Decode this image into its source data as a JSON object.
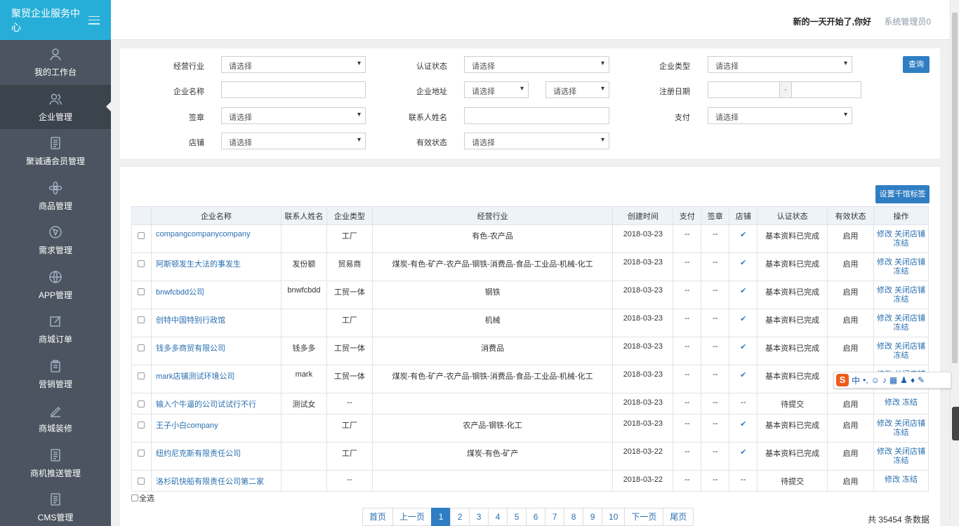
{
  "brand": {
    "title": "聚贸企业服务中心"
  },
  "sidebar": {
    "items": [
      {
        "label": "我的工作台",
        "icon": "user-icon"
      },
      {
        "label": "企业管理",
        "icon": "users-icon"
      },
      {
        "label": "聚诚通会员管理",
        "icon": "document-icon"
      },
      {
        "label": "商品管理",
        "icon": "flower-icon"
      },
      {
        "label": "需求管理",
        "icon": "compass-icon"
      },
      {
        "label": "APP管理",
        "icon": "globe-icon"
      },
      {
        "label": "商城订单",
        "icon": "edit-icon"
      },
      {
        "label": "营销管理",
        "icon": "clipboard-icon"
      },
      {
        "label": "商城装修",
        "icon": "pen-icon"
      },
      {
        "label": "商机推送管理",
        "icon": "document-icon"
      },
      {
        "label": "CMS管理",
        "icon": "document-icon"
      }
    ]
  },
  "header": {
    "greeting": "新的一天开始了,你好",
    "user": "系统管理员0"
  },
  "filters": {
    "industry_label": "经营行业",
    "industry_value": "请选择",
    "cert_label": "认证状态",
    "cert_value": "请选择",
    "type_label": "企业类型",
    "type_value": "请选择",
    "search_button": "查询",
    "name_label": "企业名称",
    "addr_label": "企业地址",
    "addr_value1": "请选择",
    "addr_value2": "请选择",
    "reg_label": "注册日期",
    "reg_sep": "-",
    "sign_label": "签章",
    "sign_value": "请选择",
    "contact_label": "联系人姓名",
    "pay_label": "支付",
    "pay_value": "请选择",
    "shop_label": "店铺",
    "shop_value": "请选择",
    "valid_label": "有效状态",
    "valid_value": "请选择"
  },
  "table": {
    "tag_button": "设置千馆标签",
    "headers": [
      "企业名称",
      "联系人姓名",
      "企业类型",
      "经营行业",
      "创建时间",
      "支付",
      "签章",
      "店铺",
      "认证状态",
      "有效状态",
      "操作"
    ],
    "rows": [
      {
        "name": "compangcompanycompany",
        "contact": "",
        "type": "工厂",
        "industry": "有色-农产品",
        "created": "2018-03-23",
        "pay": "--",
        "sign": "--",
        "shop": "✔",
        "cert": "基本资料已完成",
        "valid": "启用",
        "ops1": "修改 关闭店铺",
        "ops2": "冻结"
      },
      {
        "name": "阿斯顿发生大法的事发生",
        "contact": "发份额",
        "type": "贸易商",
        "industry": "煤炭-有色-矿产-农产品-钢铁-消费品-食品-工业品-机械-化工",
        "created": "2018-03-23",
        "pay": "--",
        "sign": "--",
        "shop": "✔",
        "cert": "基本资料已完成",
        "valid": "启用",
        "ops1": "修改 关闭店铺",
        "ops2": "冻结"
      },
      {
        "name": "bnwfcbdd公司",
        "contact": "bnwfcbdd",
        "type": "工贸一体",
        "industry": "钢铁",
        "created": "2018-03-23",
        "pay": "--",
        "sign": "--",
        "shop": "✔",
        "cert": "基本资料已完成",
        "valid": "启用",
        "ops1": "修改 关闭店铺",
        "ops2": "冻结"
      },
      {
        "name": "创特中国特别行政馆",
        "contact": "",
        "type": "工厂",
        "industry": "机械",
        "created": "2018-03-23",
        "pay": "--",
        "sign": "--",
        "shop": "✔",
        "cert": "基本资料已完成",
        "valid": "启用",
        "ops1": "修改 关闭店铺",
        "ops2": "冻结"
      },
      {
        "name": "钱多多商贸有限公司",
        "contact": "钱多多",
        "type": "工贸一体",
        "industry": "消费品",
        "created": "2018-03-23",
        "pay": "--",
        "sign": "--",
        "shop": "✔",
        "cert": "基本资料已完成",
        "valid": "启用",
        "ops1": "修改 关闭店铺",
        "ops2": "冻结"
      },
      {
        "name": "mark店铺测试环境公司",
        "contact": "mark",
        "type": "工贸一体",
        "industry": "煤炭-有色-矿产-农产品-钢铁-消费品-食品-工业品-机械-化工",
        "created": "2018-03-23",
        "pay": "--",
        "sign": "--",
        "shop": "✔",
        "cert": "基本资料已完成",
        "valid": "启用",
        "ops1": "修改 关闭店铺",
        "ops2": "冻结"
      },
      {
        "name": "输入个牛逼的公司试试行不行",
        "contact": "测试女",
        "type": "--",
        "industry": "",
        "created": "2018-03-23",
        "pay": "--",
        "sign": "--",
        "shop": "--",
        "cert": "待提交",
        "valid": "启用",
        "ops1": "修改 冻结",
        "ops2": ""
      },
      {
        "name": "王子小白company",
        "contact": "",
        "type": "工厂",
        "industry": "农产品-钢铁-化工",
        "created": "2018-03-23",
        "pay": "--",
        "sign": "--",
        "shop": "✔",
        "cert": "基本资料已完成",
        "valid": "启用",
        "ops1": "修改 关闭店铺",
        "ops2": "冻结"
      },
      {
        "name": "纽约尼克斯有限责任公司",
        "contact": "",
        "type": "工厂",
        "industry": "煤炭-有色-矿产",
        "created": "2018-03-22",
        "pay": "--",
        "sign": "--",
        "shop": "✔",
        "cert": "基本资料已完成",
        "valid": "启用",
        "ops1": "修改 关闭店铺",
        "ops2": "冻结"
      },
      {
        "name": "洛杉矶快船有限责任公司第二家",
        "contact": "",
        "type": "--",
        "industry": "",
        "created": "2018-03-22",
        "pay": "--",
        "sign": "--",
        "shop": "--",
        "cert": "待提交",
        "valid": "启用",
        "ops1": "修改 冻结",
        "ops2": ""
      }
    ],
    "select_all": "全选"
  },
  "pager": {
    "first": "首页",
    "prev": "上一页",
    "pages": [
      "1",
      "2",
      "3",
      "4",
      "5",
      "6",
      "7",
      "8",
      "9",
      "10"
    ],
    "next": "下一页",
    "last": "尾页",
    "total": "共 35454 条数据"
  },
  "ime": {
    "logo": "S",
    "mode": "中"
  }
}
